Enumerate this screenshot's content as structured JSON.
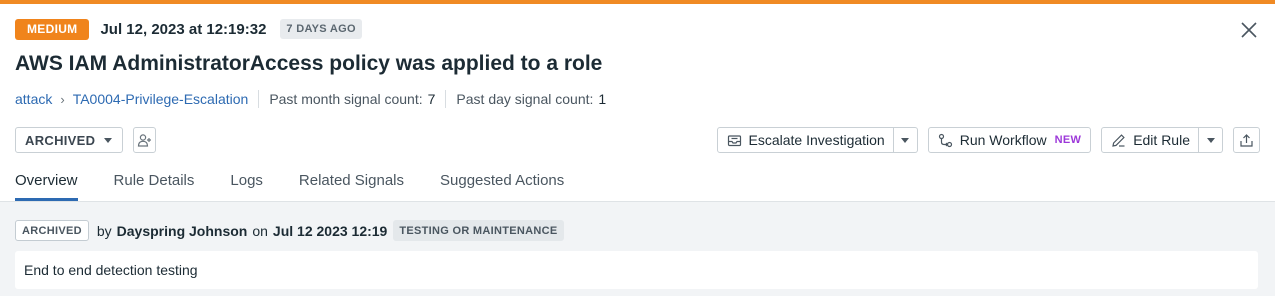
{
  "colors": {
    "accent_bar": "#f08a24",
    "severity_badge": "#f0841c",
    "link": "#2d6ab2",
    "new_tag": "#9c38d9"
  },
  "signal": {
    "severity": "MEDIUM",
    "datetime": "Jul 12, 2023 at 12:19:32",
    "age": "7 DAYS AGO",
    "title": "AWS IAM AdministratorAccess policy was applied to a role",
    "close_icon": "close-icon"
  },
  "meta": {
    "breadcrumb": [
      "attack",
      "TA0004-Privilege-Escalation"
    ],
    "breadcrumb_separator": "›",
    "month_count_label": "Past month signal count:",
    "month_count": "7",
    "day_count_label": "Past day signal count:",
    "day_count": "1"
  },
  "toolbar": {
    "status": "ARCHIVED",
    "assign_icon": "add-user-icon",
    "escalate_label": "Escalate Investigation",
    "escalate_icon": "inbox-icon",
    "workflow_label": "Run Workflow",
    "workflow_tag": "NEW",
    "workflow_icon": "workflow-icon",
    "edit_rule_label": "Edit Rule",
    "edit_icon": "pencil-icon",
    "export_icon": "export-icon"
  },
  "tabs": [
    {
      "label": "Overview",
      "active": true
    },
    {
      "label": "Rule Details",
      "active": false
    },
    {
      "label": "Logs",
      "active": false
    },
    {
      "label": "Related Signals",
      "active": false
    },
    {
      "label": "Suggested Actions",
      "active": false
    }
  ],
  "archive": {
    "status": "ARCHIVED",
    "by": "by",
    "user": "Dayspring Johnson",
    "on": "on",
    "date": "Jul 12 2023 12:19",
    "reason": "TESTING OR MAINTENANCE",
    "comment": "End to end detection testing"
  }
}
